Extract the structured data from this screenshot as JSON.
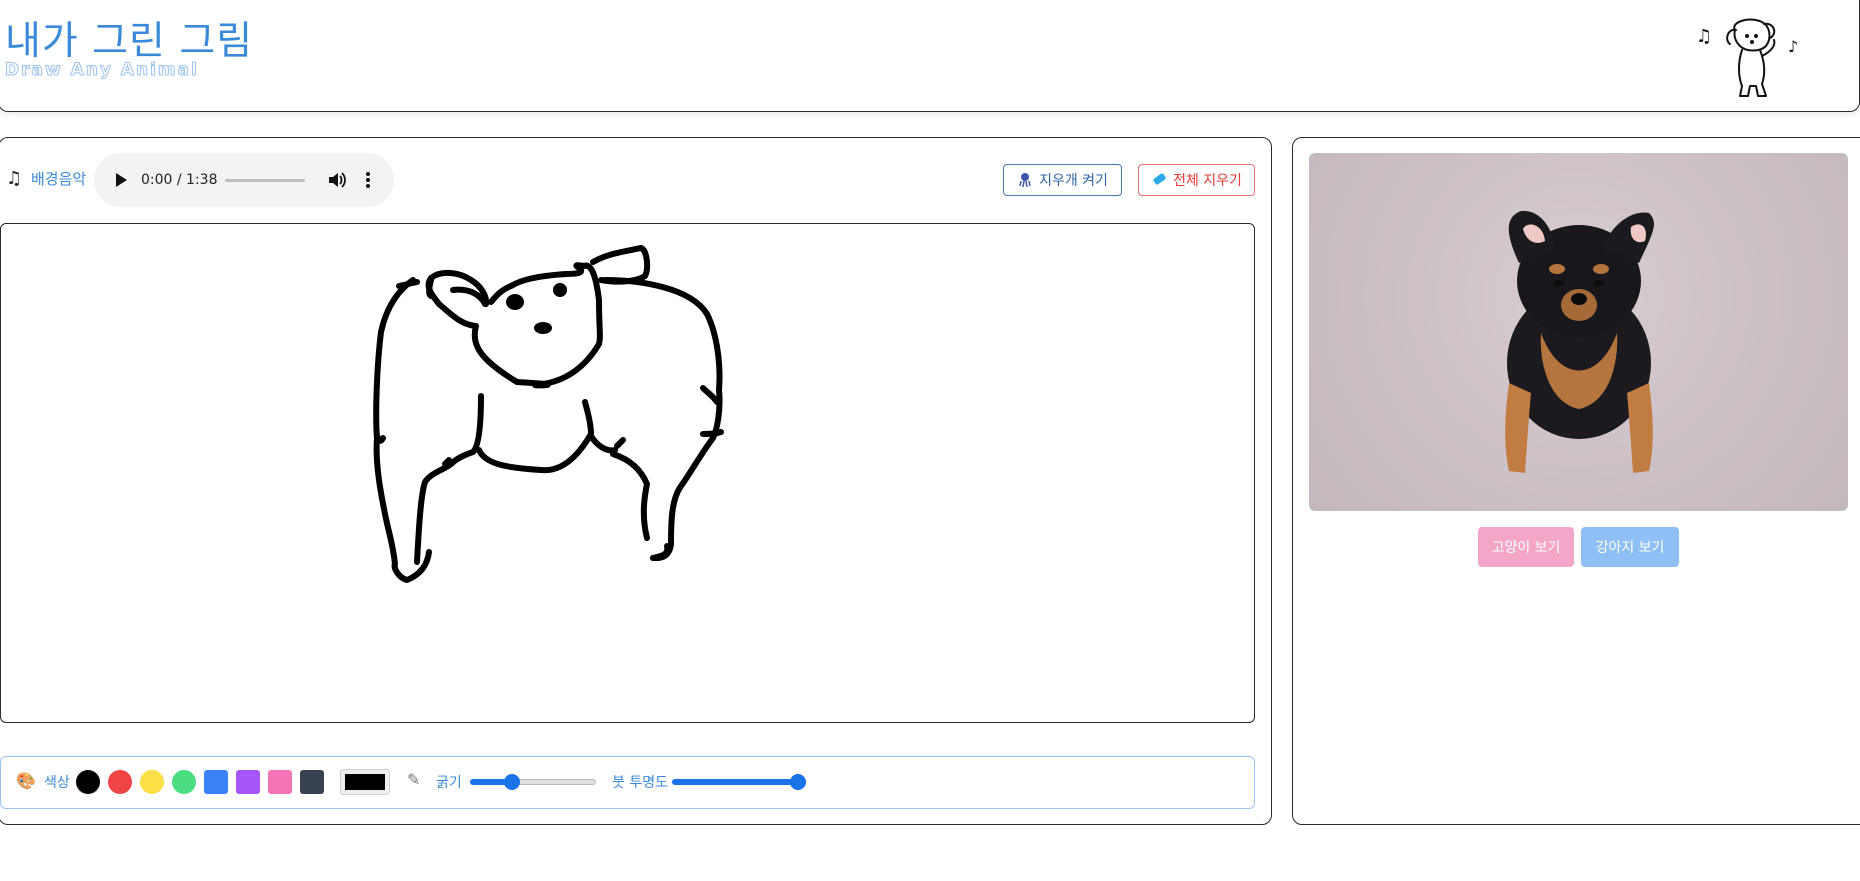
{
  "header": {
    "title": "내가 그린 그림",
    "subtitle": "Draw Any Animal"
  },
  "music": {
    "label": "배경음악",
    "time": "0:00 / 1:38"
  },
  "actions": {
    "eraser_label": "지우개 켜기",
    "clear_label": "전체 지우기"
  },
  "toolbar": {
    "color_label": "색상",
    "thickness_label": "굵기",
    "opacity_label": "붓 투명도",
    "swatches": [
      "#000000",
      "#ef4444",
      "#fde047",
      "#4ade80",
      "#3b82f6",
      "#a855f7",
      "#f472b6",
      "#374151"
    ],
    "current_color": "#000000",
    "thickness_level": 0.33,
    "opacity_level": 1.0
  },
  "reference": {
    "cat_button": "고양이 보기",
    "dog_button": "강아지 보기"
  },
  "colors": {
    "accent": "#3b8ad9",
    "clear": "#e53935",
    "cat": "#f3a6c8",
    "dog": "#8ec0f5"
  }
}
